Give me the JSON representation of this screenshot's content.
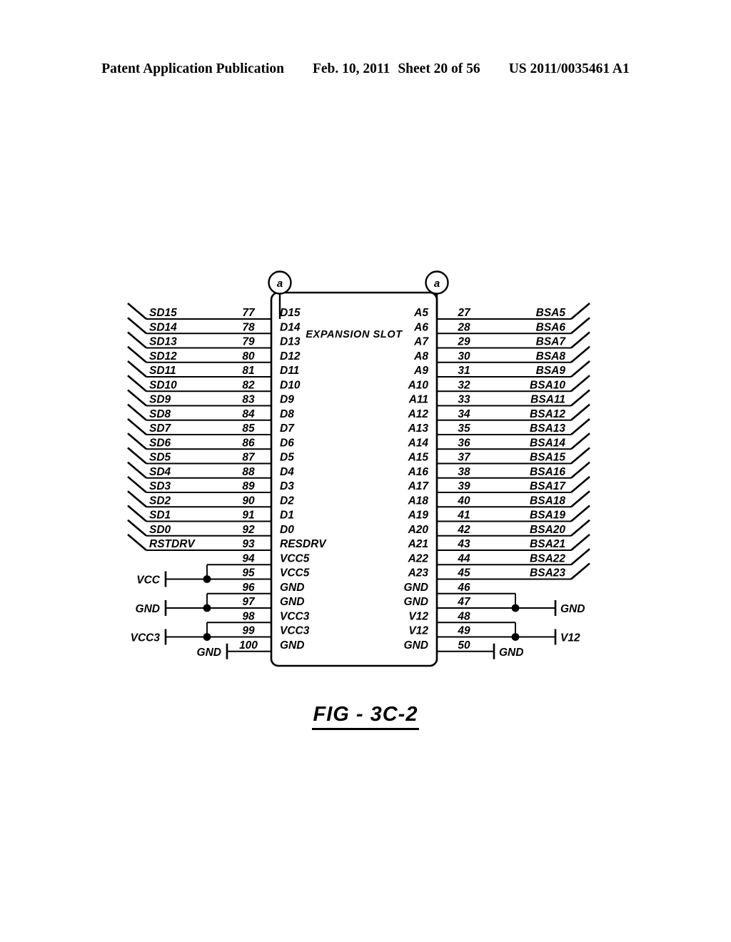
{
  "header": {
    "publication": "Patent Application Publication",
    "date": "Feb. 10, 2011",
    "sheet": "Sheet 20 of 56",
    "patent_number": "US 2011/0035461 A1"
  },
  "figure": {
    "caption": "FIG - 3C-2",
    "block_label": "EXPANSION SLOT",
    "reference_marker": "a"
  },
  "colors": {
    "ink": "#000000",
    "paper": "#ffffff"
  },
  "left_rows": [
    {
      "signal": "SD15",
      "pin": "77",
      "name": "D15"
    },
    {
      "signal": "SD14",
      "pin": "78",
      "name": "D14"
    },
    {
      "signal": "SD13",
      "pin": "79",
      "name": "D13"
    },
    {
      "signal": "SD12",
      "pin": "80",
      "name": "D12"
    },
    {
      "signal": "SD11",
      "pin": "81",
      "name": "D11"
    },
    {
      "signal": "SD10",
      "pin": "82",
      "name": "D10"
    },
    {
      "signal": "SD9",
      "pin": "83",
      "name": "D9"
    },
    {
      "signal": "SD8",
      "pin": "84",
      "name": "D8"
    },
    {
      "signal": "SD7",
      "pin": "85",
      "name": "D7"
    },
    {
      "signal": "SD6",
      "pin": "86",
      "name": "D6"
    },
    {
      "signal": "SD5",
      "pin": "87",
      "name": "D5"
    },
    {
      "signal": "SD4",
      "pin": "88",
      "name": "D4"
    },
    {
      "signal": "SD3",
      "pin": "89",
      "name": "D3"
    },
    {
      "signal": "SD2",
      "pin": "90",
      "name": "D2"
    },
    {
      "signal": "SD1",
      "pin": "91",
      "name": "D1"
    },
    {
      "signal": "SD0",
      "pin": "92",
      "name": "D0"
    },
    {
      "signal": "RSTDRV",
      "pin": "93",
      "name": "RESDRV"
    },
    {
      "signal": "",
      "pin": "94",
      "name": "VCC5"
    },
    {
      "signal": "",
      "pin": "95",
      "name": "VCC5"
    },
    {
      "signal": "",
      "pin": "96",
      "name": "GND"
    },
    {
      "signal": "",
      "pin": "97",
      "name": "GND"
    },
    {
      "signal": "",
      "pin": "98",
      "name": "VCC3"
    },
    {
      "signal": "",
      "pin": "99",
      "name": "VCC3"
    },
    {
      "signal": "",
      "pin": "100",
      "name": "GND"
    }
  ],
  "right_rows": [
    {
      "name": "A5",
      "pin": "27",
      "signal": "BSA5"
    },
    {
      "name": "A6",
      "pin": "28",
      "signal": "BSA6"
    },
    {
      "name": "A7",
      "pin": "29",
      "signal": "BSA7"
    },
    {
      "name": "A8",
      "pin": "30",
      "signal": "BSA8"
    },
    {
      "name": "A9",
      "pin": "31",
      "signal": "BSA9"
    },
    {
      "name": "A10",
      "pin": "32",
      "signal": "BSA10"
    },
    {
      "name": "A11",
      "pin": "33",
      "signal": "BSA11"
    },
    {
      "name": "A12",
      "pin": "34",
      "signal": "BSA12"
    },
    {
      "name": "A13",
      "pin": "35",
      "signal": "BSA13"
    },
    {
      "name": "A14",
      "pin": "36",
      "signal": "BSA14"
    },
    {
      "name": "A15",
      "pin": "37",
      "signal": "BSA15"
    },
    {
      "name": "A16",
      "pin": "38",
      "signal": "BSA16"
    },
    {
      "name": "A17",
      "pin": "39",
      "signal": "BSA17"
    },
    {
      "name": "A18",
      "pin": "40",
      "signal": "BSA18"
    },
    {
      "name": "A19",
      "pin": "41",
      "signal": "BSA19"
    },
    {
      "name": "A20",
      "pin": "42",
      "signal": "BSA20"
    },
    {
      "name": "A21",
      "pin": "43",
      "signal": "BSA21"
    },
    {
      "name": "A22",
      "pin": "44",
      "signal": "BSA22"
    },
    {
      "name": "A23",
      "pin": "45",
      "signal": "BSA23"
    },
    {
      "name": "GND",
      "pin": "46",
      "signal": ""
    },
    {
      "name": "GND",
      "pin": "47",
      "signal": ""
    },
    {
      "name": "V12",
      "pin": "48",
      "signal": ""
    },
    {
      "name": "V12",
      "pin": "49",
      "signal": ""
    },
    {
      "name": "GND",
      "pin": "50",
      "signal": ""
    }
  ],
  "left_power_rails": [
    {
      "label": "VCC",
      "pins": [
        "94",
        "95"
      ]
    },
    {
      "label": "GND",
      "pins": [
        "96",
        "97"
      ]
    },
    {
      "label": "VCC3",
      "pins": [
        "98",
        "99"
      ]
    },
    {
      "label": "GND",
      "pins": [
        "100"
      ]
    }
  ],
  "right_power_rails": [
    {
      "label": "GND",
      "pins": [
        "46",
        "47"
      ]
    },
    {
      "label": "V12",
      "pins": [
        "48",
        "49"
      ]
    },
    {
      "label": "GND",
      "pins": [
        "50"
      ]
    }
  ]
}
